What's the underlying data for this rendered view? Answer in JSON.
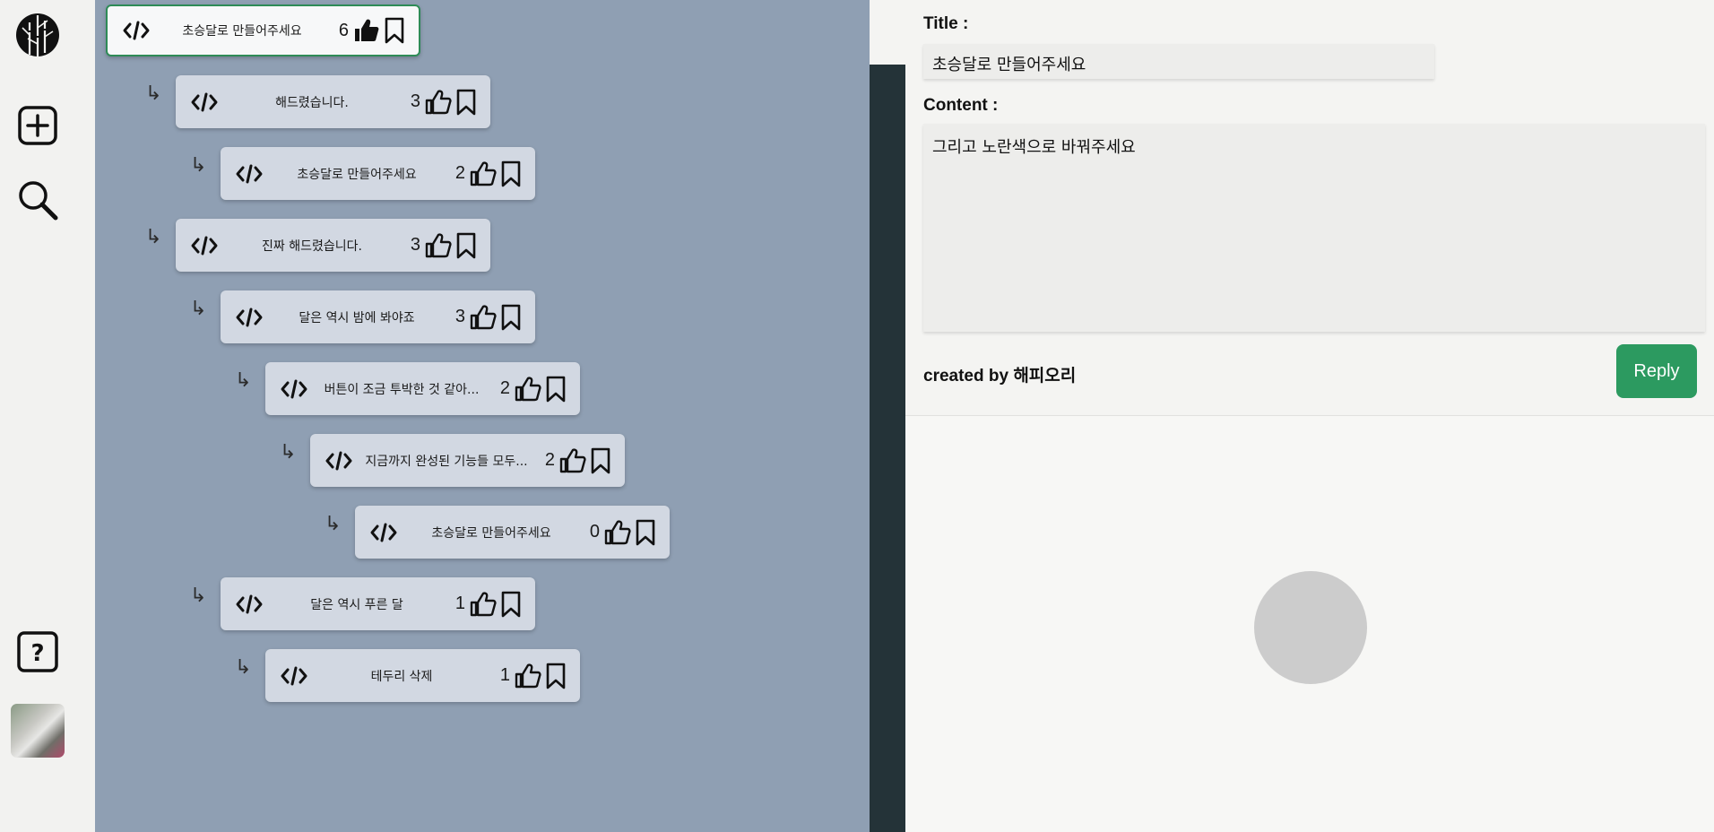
{
  "sidebar": {
    "logo_icon": "bamboo-logo-icon",
    "add_icon": "plus-square-icon",
    "search_icon": "search-icon",
    "help_label": "?"
  },
  "thread": {
    "nodes": [
      {
        "title": "초승달로 만들어주세요",
        "likes": "6",
        "liked": true,
        "selected": true
      },
      {
        "title": "해드렸습니다.",
        "likes": "3",
        "liked": false
      },
      {
        "title": "초승달로 만들어주세요",
        "likes": "2",
        "liked": false
      },
      {
        "title": "진짜 해드렸습니다.",
        "likes": "3",
        "liked": false
      },
      {
        "title": "달은 역시 밤에 봐야죠",
        "likes": "3",
        "liked": false
      },
      {
        "title": "버튼이 조금 투박한 것 같아...",
        "likes": "2",
        "liked": false
      },
      {
        "title": "지금까지 완성된 기능들 모두...",
        "likes": "2",
        "liked": false
      },
      {
        "title": "초승달로 만들어주세요",
        "likes": "0",
        "liked": false
      },
      {
        "title": "달은 역시 푸른 달",
        "likes": "1",
        "liked": false
      },
      {
        "title": "테두리 삭제",
        "likes": "1",
        "liked": false
      }
    ],
    "reply_arrow": "↳"
  },
  "detail": {
    "title_label": "Title :",
    "title_value": "초승달로 만들어주세요",
    "content_label": "Content :",
    "content_value": "그리고 노란색으로 바꿔주세요",
    "created_by": "created by 해피오리",
    "reply_label": "Reply"
  },
  "colors": {
    "panel_bg": "#8f9fb3",
    "node_bg": "#d2d8e2",
    "accent": "#2c9a60"
  }
}
